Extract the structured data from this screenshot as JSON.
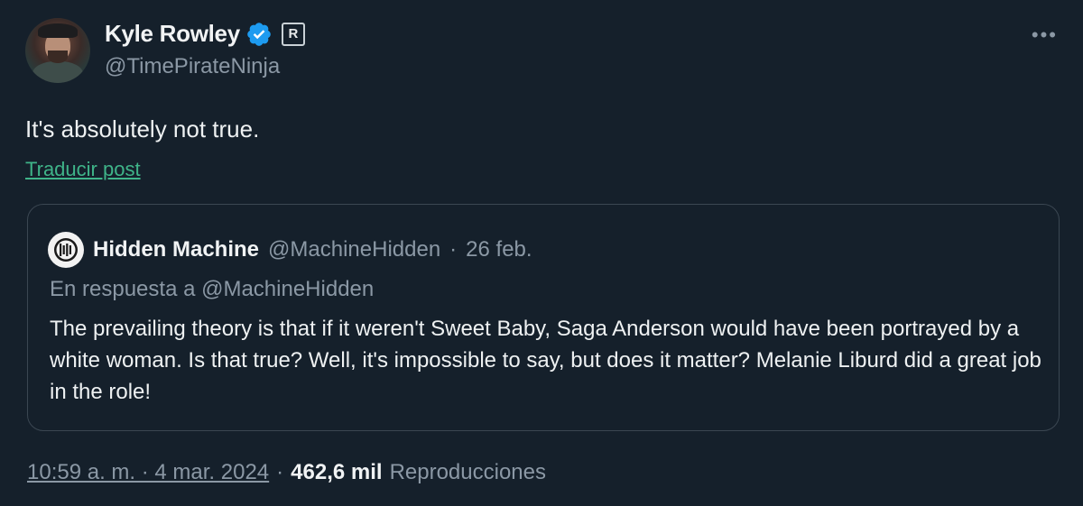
{
  "author": {
    "display_name": "Kyle Rowley",
    "handle": "@TimePirateNinja",
    "verified": true,
    "affiliation_badge": "R"
  },
  "more_icon": "more-horizontal-icon",
  "post": {
    "text": "It's absolutely not true.",
    "translate_label": "Traducir post"
  },
  "quoted": {
    "display_name": "Hidden Machine",
    "handle": "@MachineHidden",
    "separator": "·",
    "date": "26 feb.",
    "reply_to": "En respuesta a @MachineHidden",
    "text": "The prevailing theory is that if it weren't Sweet Baby, Saga Anderson would have been portrayed by a white woman. Is that true? Well, it's impossible to say, but does it matter? Melanie Liburd did a great job in the role!"
  },
  "meta": {
    "time": "10:59 a. m. · 4 mar. 2024",
    "dot": "·",
    "views_count": "462,6 mil",
    "views_label": "Reproducciones"
  },
  "colors": {
    "background": "#15202b",
    "verified": "#1d9bf0",
    "link": "#3fb489",
    "secondary_text": "#8b98a5"
  }
}
